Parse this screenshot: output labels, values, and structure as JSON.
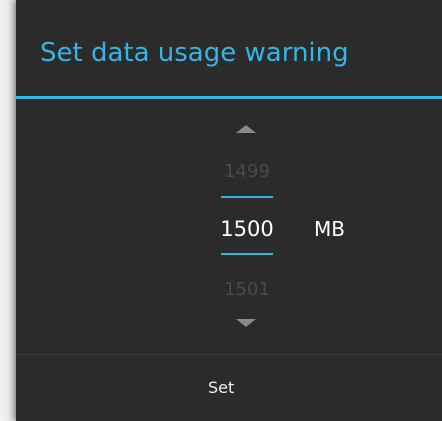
{
  "dialog": {
    "title": "Set data usage warning"
  },
  "picker": {
    "previous_value": "1499",
    "current_value": "1500",
    "next_value": "1501",
    "unit": "MB",
    "increment_icon": "arrow-up-icon",
    "decrement_icon": "arrow-down-icon"
  },
  "actions": {
    "set_label": "Set"
  },
  "colors": {
    "accent": "#33b5e5",
    "dialog_background": "#2b2b2b"
  }
}
